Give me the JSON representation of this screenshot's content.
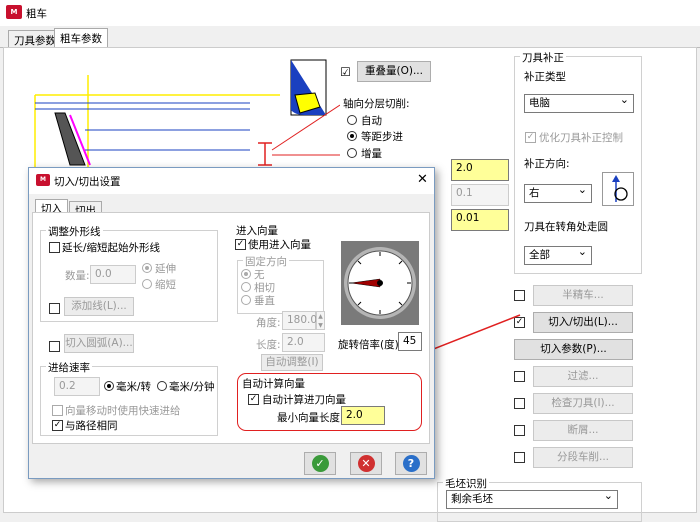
{
  "window": {
    "title": "粗车"
  },
  "tabs": [
    "刀具参数",
    "粗车参数"
  ],
  "overlap": {
    "checked": "☑",
    "button": "重叠量(O)..."
  },
  "axial": {
    "title": "轴向分层切削:",
    "options": [
      "自动",
      "等距步进",
      "增量"
    ],
    "selected_index": 1
  },
  "values": {
    "v1": "2.0",
    "v2": "0.1",
    "v3": "0.01"
  },
  "comp": {
    "group_title": "刀具补正",
    "type_label": "补正类型",
    "type_value": "电脑",
    "optimize_label": "优化刀具补正控制",
    "dir_label": "补正方向:",
    "dir_value": "右",
    "corner_label": "刀具在转角处走圆",
    "corner_value": "全部"
  },
  "right_buttons": [
    {
      "label": "半精车...",
      "checked": false,
      "enabled": false
    },
    {
      "label": "切入/切出(L)...",
      "checked": true,
      "enabled": true
    },
    {
      "label": "切入参数(P)...",
      "checked": null,
      "enabled": true
    },
    {
      "label": "过滤...",
      "checked": false,
      "enabled": false
    },
    {
      "label": "检查刀具(I)...",
      "checked": false,
      "enabled": false
    },
    {
      "label": "断屑...",
      "checked": false,
      "enabled": false
    },
    {
      "label": "分段车削...",
      "checked": false,
      "enabled": false
    }
  ],
  "stock": {
    "label": "毛坯识别",
    "value": "剩余毛坯"
  },
  "dialog": {
    "title": "切入/切出设置",
    "tabs": [
      "切入",
      "切出"
    ],
    "adjust": {
      "title": "调整外形线",
      "extend_label": "延长/缩短起始外形线",
      "qty_label": "数量:",
      "qty_value": "0.0",
      "extend_opts": [
        "延伸",
        "缩短"
      ],
      "add_line": "添加线(L)..."
    },
    "arc_button": "切入圆弧(A)...",
    "feed": {
      "title": "进给速率",
      "value": "0.2",
      "unit_opts": [
        "毫米/转",
        "毫米/分钟"
      ],
      "rapid_label": "向量移动时使用快速进给",
      "same_label": "与路径相同"
    },
    "vector": {
      "title": "进入向量",
      "use_label": "使用进入向量",
      "fixed_title": "固定方向",
      "fixed_opts": [
        "无",
        "相切",
        "垂直"
      ],
      "angle_label": "角度:",
      "angle_value": "180.0",
      "length_label": "长度:",
      "length_value": "2.0",
      "rotation_label": "旋转倍率(度):",
      "rotation_value": "45",
      "auto_adjust": "自动调整(I)"
    },
    "auto": {
      "title": "自动计算向量",
      "check_label": "自动计算进刀向量",
      "min_label": "最小向量长度:",
      "min_value": "2.0"
    }
  },
  "colors": {
    "highlight": "#ffff99",
    "annotation": "#e02020",
    "ok": "#3a9a3a",
    "cancel": "#d03030",
    "help": "#2a6fc9"
  }
}
